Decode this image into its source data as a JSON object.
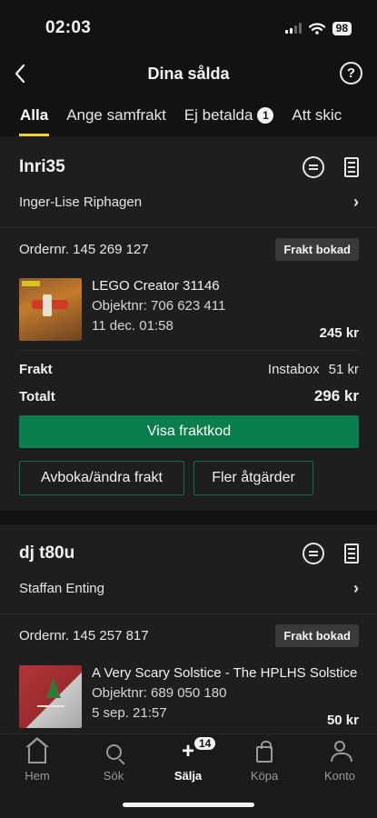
{
  "status_bar": {
    "time": "02:03",
    "battery": "98"
  },
  "header": {
    "title": "Dina sålda",
    "help": "?"
  },
  "tabs": [
    {
      "label": "Alla"
    },
    {
      "label": "Ange samfrakt"
    },
    {
      "label": "Ej betalda",
      "badge": "1"
    },
    {
      "label": "Att skic"
    }
  ],
  "orders": [
    {
      "seller": "Inri35",
      "buyer": "Inger-Lise Riphagen",
      "order_number": "Ordernr. 145 269 127",
      "status": "Frakt bokad",
      "item": {
        "title": "LEGO Creator 31146",
        "object_nr": "Objektnr: 706 623 411",
        "date": "11 dec. 01:58",
        "price": "245 kr"
      },
      "shipping_label": "Frakt",
      "shipping_method": "Instabox",
      "shipping_price": "51 kr",
      "total_label": "Totalt",
      "total": "296 kr",
      "primary_action": "Visa fraktkod",
      "secondary_action_1": "Avboka/ändra frakt",
      "secondary_action_2": "Fler åtgärder"
    },
    {
      "seller": "dj t80u",
      "buyer": "Staffan Enting",
      "order_number": "Ordernr. 145 257 817",
      "status": "Frakt bokad",
      "item": {
        "title": "A Very Scary Solstice - The HPLHS Solstice",
        "object_nr": "Objektnr: 689 050 180",
        "date": "5 sep. 21:57",
        "price": "50 kr"
      }
    }
  ],
  "bottom_nav": [
    {
      "label": "Hem",
      "icon": "home-icon"
    },
    {
      "label": "Sök",
      "icon": "search-icon"
    },
    {
      "label": "Sälja",
      "icon": "plus-icon",
      "badge": "14"
    },
    {
      "label": "Köpa",
      "icon": "bag-icon"
    },
    {
      "label": "Konto",
      "icon": "user-icon"
    }
  ],
  "colors": {
    "accent_tab": "#f3d51c",
    "primary_button": "#0a7f4d",
    "background": "#121212"
  }
}
